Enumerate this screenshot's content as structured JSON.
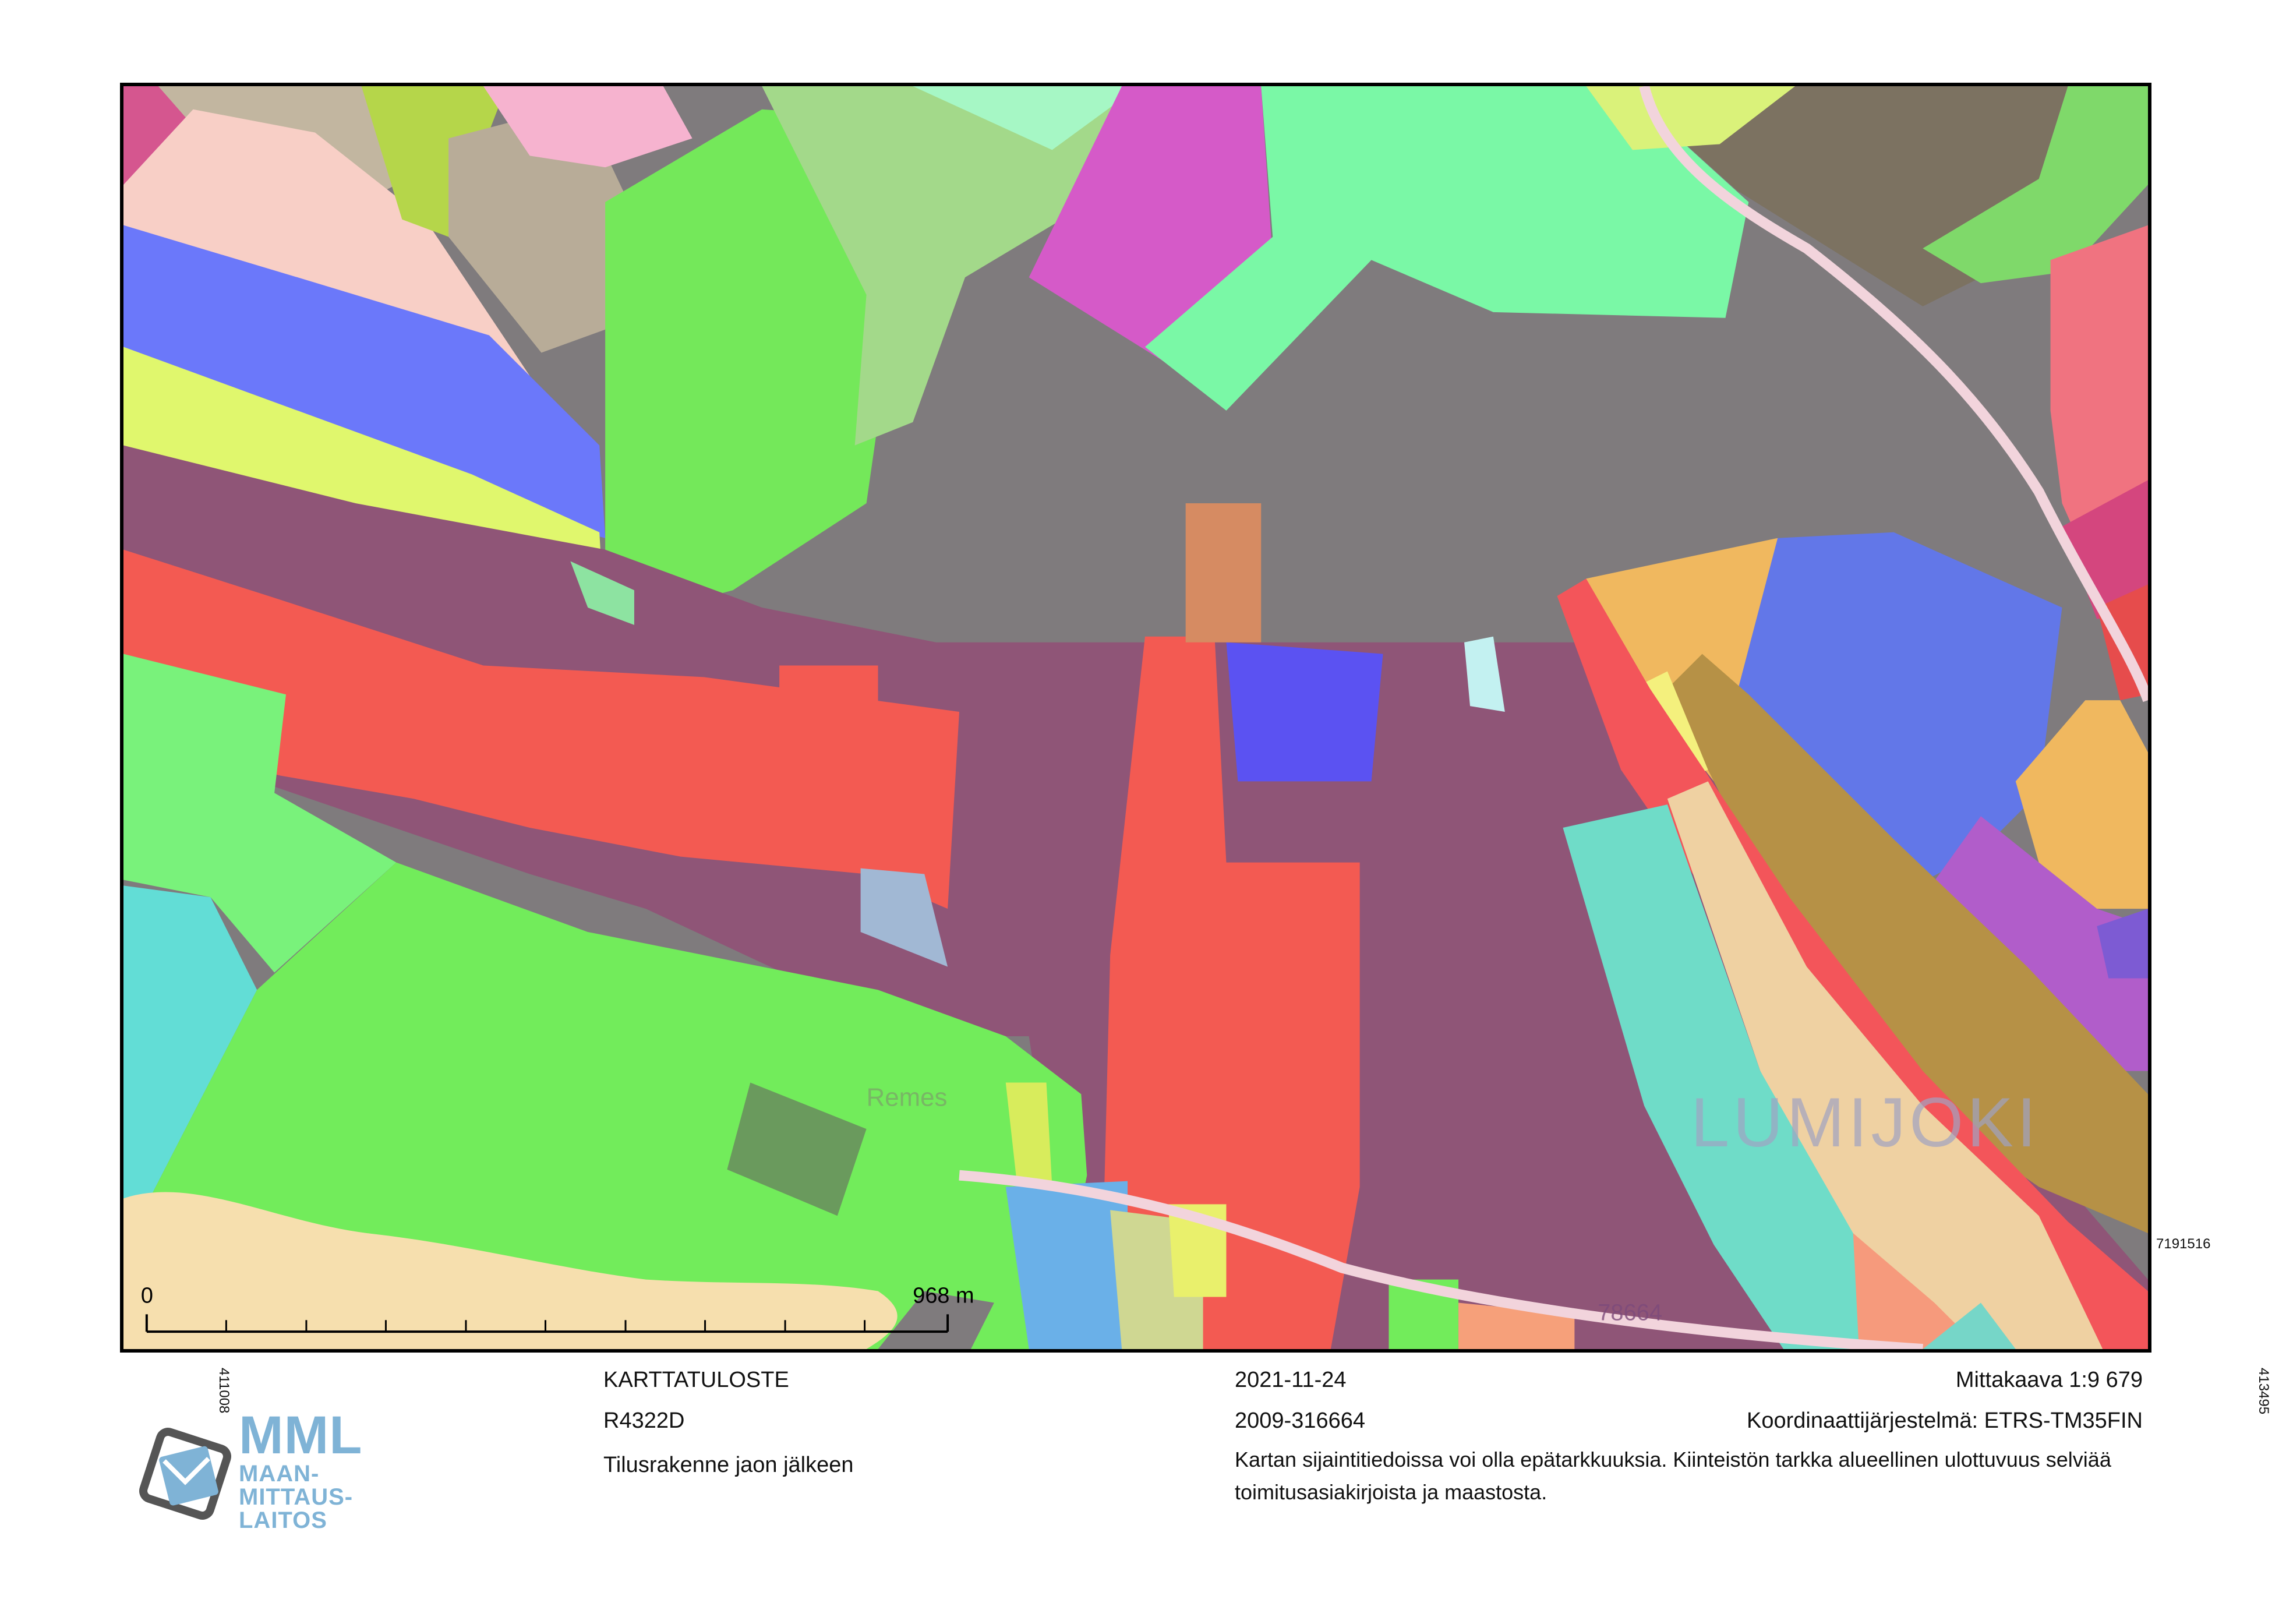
{
  "map": {
    "place_label": "LUMIJOKI",
    "village_label": "Remes",
    "parcel_numbers": [
      "78664"
    ],
    "scale_bar": {
      "start_label": "0",
      "end_label": "968 m"
    },
    "coord_right": "7191516",
    "coord_bottom_left": "411008",
    "coord_bottom_right": "413495",
    "colors": {
      "water": "#f6dfae",
      "road": "#f2d4dc",
      "dark_parcel": "#7f7b7d",
      "maroon_parcel": "#8f5577",
      "red_parcel": "#f35a52",
      "green_parcel": "#72ec5b"
    }
  },
  "footer": {
    "doc_type": "KARTTATULOSTE",
    "code": "R4322D",
    "description": "Tilusrakenne jaon jälkeen",
    "date": "2021-11-24",
    "reference": "2009-316664",
    "scale": "Mittakaava 1:9 679",
    "coordinate_system": "Koordinaattijärjestelmä: ETRS-TM35FIN",
    "disclaimer": "Kartan sijaintitiedoissa voi olla epätarkkuuksia. Kiinteistön tarkka alueellinen ulottuvuus selviää toimitusasiakirjoista ja maastosta."
  },
  "logo": {
    "line1": "MML",
    "line2": "MAAN-",
    "line3": "MITTAUS-",
    "line4": "LAITOS"
  }
}
